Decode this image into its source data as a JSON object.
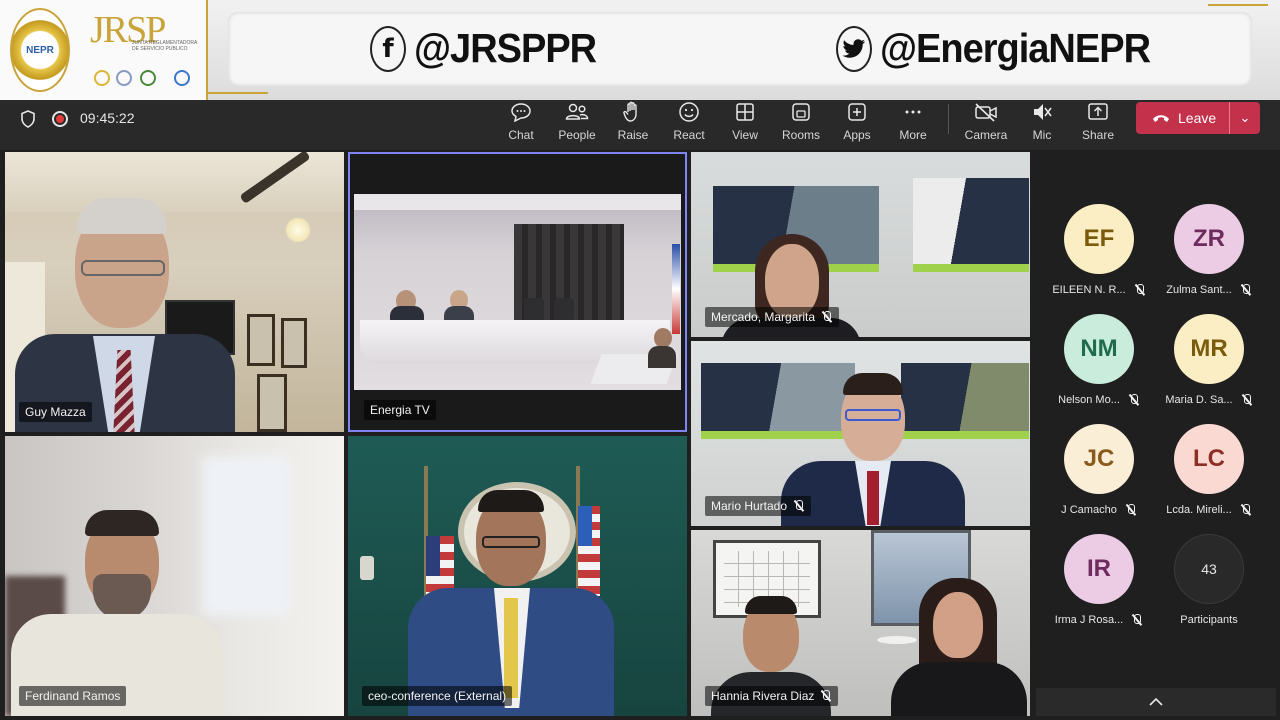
{
  "banner": {
    "org_logo_text": "JRSP",
    "org_logo_subtext": "JUNTA REGLAMENTADORA DE SERVICIO PUBLICO",
    "seal_text": "NEPR",
    "facebook_icon": "facebook-icon",
    "facebook_handle": "@JRSPPR",
    "twitter_icon": "twitter-icon",
    "twitter_handle": "@EnergiaNEPR",
    "accent_color": "#c8a43a"
  },
  "toolbar": {
    "timer": "09:45:22",
    "buttons": [
      {
        "label": "Chat",
        "icon": "chat-icon"
      },
      {
        "label": "People",
        "icon": "people-icon"
      },
      {
        "label": "Raise",
        "icon": "raise-hand-icon"
      },
      {
        "label": "React",
        "icon": "react-icon"
      },
      {
        "label": "View",
        "icon": "view-icon"
      },
      {
        "label": "Rooms",
        "icon": "rooms-icon"
      },
      {
        "label": "Apps",
        "icon": "apps-icon"
      },
      {
        "label": "More",
        "icon": "more-icon"
      },
      {
        "label": "Camera",
        "icon": "camera-off-icon"
      },
      {
        "label": "Mic",
        "icon": "mic-off-icon"
      },
      {
        "label": "Share",
        "icon": "share-icon"
      }
    ],
    "leave_label": "Leave",
    "leave_color": "#c4314b"
  },
  "videos": [
    {
      "name": "Guy Mazza",
      "muted": false
    },
    {
      "name": "Energia TV",
      "muted": false
    },
    {
      "name": "Mercado, Margarita",
      "muted": true
    },
    {
      "name": "Mario Hurtado",
      "muted": true
    },
    {
      "name": "Ferdinand Ramos",
      "muted": false
    },
    {
      "name": "ceo-conference (External)",
      "muted": false
    },
    {
      "name": "Hannia Rivera Diaz",
      "muted": true
    }
  ],
  "participants": {
    "list": [
      {
        "initials": "EF",
        "name": "EILEEN N. R...",
        "bg": "#fbeec4",
        "fg": "#7a5a0b"
      },
      {
        "initials": "ZR",
        "name": "Zulma Sant...",
        "bg": "#eccce4",
        "fg": "#6e2b5e"
      },
      {
        "initials": "NM",
        "name": "Nelson Mo...",
        "bg": "#c9ecdc",
        "fg": "#1f6b4b"
      },
      {
        "initials": "MR",
        "name": "Maria D. Sa...",
        "bg": "#fbeec4",
        "fg": "#7a5a0b"
      },
      {
        "initials": "JC",
        "name": "J Camacho",
        "bg": "#fbeed6",
        "fg": "#8a5a1c"
      },
      {
        "initials": "LC",
        "name": "Lcda. Mireli...",
        "bg": "#fbd9d3",
        "fg": "#8c2f24"
      },
      {
        "initials": "IR",
        "name": "Irma J Rosa...",
        "bg": "#eccce4",
        "fg": "#6e2b5e"
      }
    ],
    "count": "43",
    "count_label": "Participants"
  },
  "panel": {
    "collapse_icon": "chevron-up-icon"
  }
}
